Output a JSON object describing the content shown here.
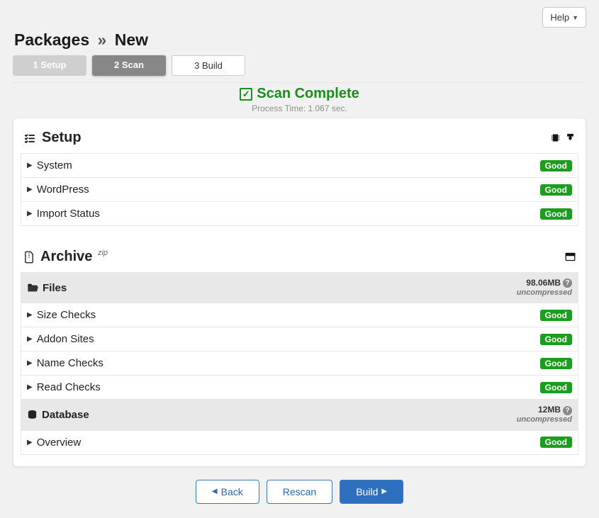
{
  "help_label": "Help",
  "breadcrumb": {
    "root": "Packages",
    "sep": "»",
    "current": "New"
  },
  "steps": [
    {
      "num": "1",
      "label": "Setup",
      "state": "disabled"
    },
    {
      "num": "2",
      "label": "Scan",
      "state": "active"
    },
    {
      "num": "3",
      "label": "Build",
      "state": "next"
    }
  ],
  "scan": {
    "title": "Scan Complete",
    "subtitle": "Process Time: 1.067 sec."
  },
  "setup_section": {
    "title": "Setup",
    "rows": [
      {
        "label": "System",
        "badge": "Good"
      },
      {
        "label": "WordPress",
        "badge": "Good"
      },
      {
        "label": "Import Status",
        "badge": "Good"
      }
    ]
  },
  "archive_section": {
    "title": "Archive",
    "title_sup": "zip",
    "files_group": {
      "label": "Files",
      "size": "98.06MB",
      "note": "uncompressed"
    },
    "file_rows": [
      {
        "label": "Size Checks",
        "badge": "Good"
      },
      {
        "label": "Addon Sites",
        "badge": "Good"
      },
      {
        "label": "Name Checks",
        "badge": "Good"
      },
      {
        "label": "Read Checks",
        "badge": "Good"
      }
    ],
    "database_group": {
      "label": "Database",
      "size": "12MB",
      "note": "uncompressed"
    },
    "db_rows": [
      {
        "label": "Overview",
        "badge": "Good"
      }
    ]
  },
  "actions": {
    "back": "Back",
    "rescan": "Rescan",
    "build": "Build"
  }
}
